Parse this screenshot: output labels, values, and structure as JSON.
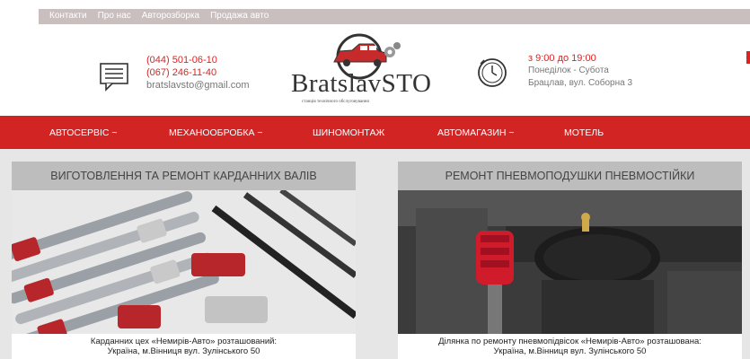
{
  "topnav": [
    "Контакти",
    "Про нас",
    "Авторозборка",
    "Продажа авто"
  ],
  "contacts": {
    "phone1": "(044) 501-06-10",
    "phone2": "(067) 246-11-40",
    "email": "bratslavsto@gmail.com"
  },
  "logo": {
    "name": "BratslavSTO",
    "tagline": "станція технічного обслуговування"
  },
  "hours": {
    "time": "з 9:00 до 19:00",
    "days": "Понеділок - Субота",
    "address": "Брацлав, вул. Соборна 3"
  },
  "mainnav": [
    "АВТОСЕРВІС ~",
    "МЕХАНООБРОБКА ~",
    "ШИНОМОНТАЖ",
    "АВТОМАГАЗИН ~",
    "МОТЕЛЬ"
  ],
  "cards": [
    {
      "title": "ВИГОТОВЛЕННЯ ТА РЕМОНТ КАРДАННИХ ВАЛІВ",
      "caption1": "Карданних цех «Немирів-Авто» розташований:",
      "caption2": "Україна, м.Вінниця вул. Зулінського 50"
    },
    {
      "title": "РЕМОНТ ПНЕВМОПОДУШКИ ПНЕВМОСТІЙКИ",
      "caption1": "Ділянка по ремонту пневмопідвісок «Немирів-Авто» розташована:",
      "caption2": "Україна, м.Вінниця вул. Зулінського 50"
    }
  ],
  "colors": {
    "accent": "#d32424",
    "topbar": "#c9bfbf",
    "card_header": "#bdbdbd"
  }
}
